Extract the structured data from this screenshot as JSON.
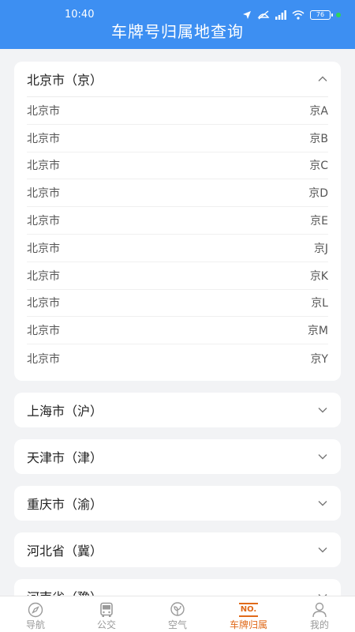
{
  "status_bar": {
    "time": "10:40",
    "battery": "76"
  },
  "header": {
    "title": "车牌号归属地查询"
  },
  "expanded_section": {
    "title": "北京市（京）",
    "rows": [
      {
        "city": "北京市",
        "code": "京A"
      },
      {
        "city": "北京市",
        "code": "京B"
      },
      {
        "city": "北京市",
        "code": "京C"
      },
      {
        "city": "北京市",
        "code": "京D"
      },
      {
        "city": "北京市",
        "code": "京E"
      },
      {
        "city": "北京市",
        "code": "京J"
      },
      {
        "city": "北京市",
        "code": "京K"
      },
      {
        "city": "北京市",
        "code": "京L"
      },
      {
        "city": "北京市",
        "code": "京M"
      },
      {
        "city": "北京市",
        "code": "京Y"
      }
    ]
  },
  "collapsed_sections": [
    {
      "title": "上海市（沪）"
    },
    {
      "title": "天津市（津）"
    },
    {
      "title": "重庆市（渝）"
    },
    {
      "title": "河北省（冀）"
    },
    {
      "title": "河南省（豫）"
    }
  ],
  "tabbar": {
    "items": [
      {
        "label": "导航",
        "icon": "compass-icon"
      },
      {
        "label": "公交",
        "icon": "bus-icon"
      },
      {
        "label": "空气",
        "icon": "leaf-icon"
      },
      {
        "label": "车牌归属",
        "icon": "plate-icon",
        "badge": "NO."
      },
      {
        "label": "我的",
        "icon": "user-icon"
      }
    ],
    "active_color": "#e06a1a",
    "inactive_color": "#9a9a9a"
  },
  "colors": {
    "header": "#3d8ff2",
    "background": "#f2f3f5"
  }
}
